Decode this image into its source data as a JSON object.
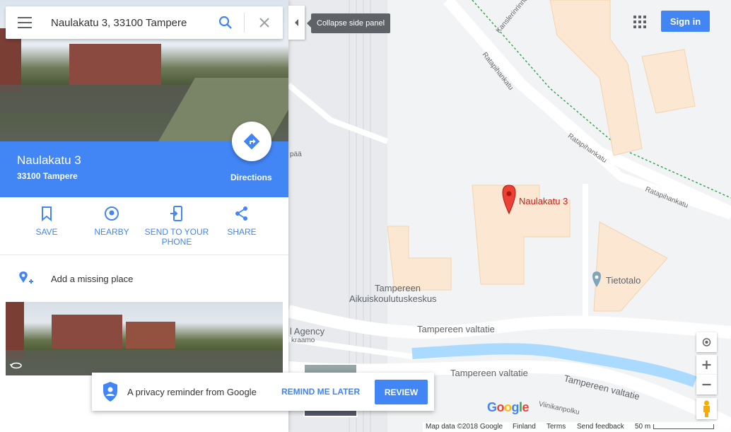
{
  "search": {
    "value": "Naulakatu 3, 33100 Tampere"
  },
  "collapse": {
    "tooltip": "Collapse side panel"
  },
  "place": {
    "title": "Naulakatu 3",
    "subtitle": "33100 Tampere",
    "directions_label": "Directions"
  },
  "actions": [
    {
      "label": "SAVE",
      "icon": "bookmark-icon"
    },
    {
      "label": "NEARBY",
      "icon": "nearby-pin-icon"
    },
    {
      "label": "SEND TO YOUR PHONE",
      "icon": "send-to-phone-icon"
    },
    {
      "label": "SHARE",
      "icon": "share-icon"
    }
  ],
  "missing_place": {
    "label": "Add a missing place"
  },
  "header": {
    "sign_in": "Sign in"
  },
  "privacy": {
    "text": "A privacy reminder from Google",
    "remind_later": "REMIND ME LATER",
    "review": "REVIEW"
  },
  "map": {
    "pin_label": "Naulakatu 3",
    "poi_tietotalo": "Tietotalo",
    "poi_school_line1": "Tampereen",
    "poi_school_line2": "Aikuiskoulutuskeskus",
    "poi_agency_line1": "l Agency",
    "poi_agency_line2": "kraamo",
    "poi_paa": "pää",
    "roads": {
      "ratapihankatu_top": "Ratapihankatu",
      "ratapihankatu_mid": "Ratapihankatu",
      "ratapihankatu_right": "Ratapihankatu",
      "kansleri": "Kanslerinrinne",
      "valtatie_1": "Tampereen valtatie",
      "valtatie_2": "Tampereen valtatie",
      "valtatie_3": "Tampereen valtatie",
      "viinikanpolku": "Viinikanpolku"
    },
    "logo": "Google"
  },
  "footer": {
    "map_data": "Map data ©2018 Google",
    "region": "Finland",
    "terms": "Terms",
    "feedback": "Send feedback",
    "scale": "50 m"
  },
  "colors": {
    "accent": "#4285f4",
    "pin": "#ea4335",
    "building": "#fce8d2",
    "water": "#aadaff"
  }
}
